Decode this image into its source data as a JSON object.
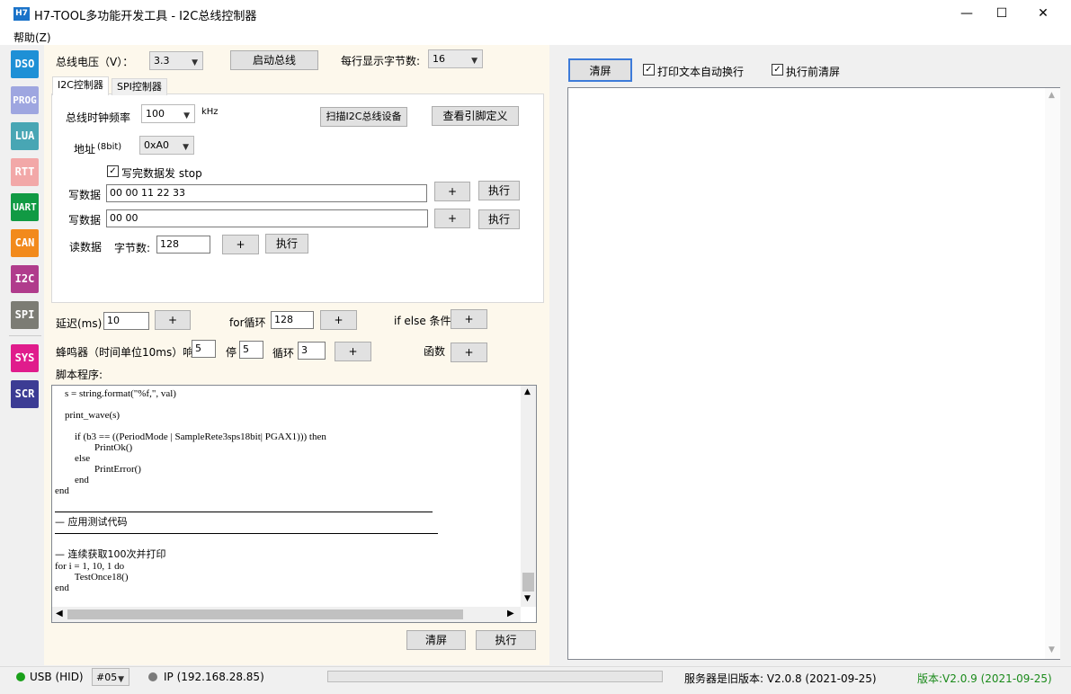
{
  "window": {
    "title": "H7-TOOL多功能开发工具 - I2C总线控制器",
    "icon_text": "H7",
    "minimize": "—",
    "maximize": "☐",
    "close": "✕"
  },
  "menu": {
    "help": "帮助(Z)"
  },
  "sidebar": [
    {
      "label": "DSO",
      "color": "#1e90d6"
    },
    {
      "label": "PROG",
      "color": "#9ea6e0"
    },
    {
      "label": "LUA",
      "color": "#48a6b4"
    },
    {
      "label": "RTT",
      "color": "#f2a8a8"
    },
    {
      "label": "UART",
      "color": "#119a44"
    },
    {
      "label": "CAN",
      "color": "#f28a1c"
    },
    {
      "label": "I2C",
      "color": "#b03c8c"
    },
    {
      "label": "SPI",
      "color": "#7c7c74"
    },
    {
      "label": "SYS",
      "color": "#e01c8c"
    },
    {
      "label": "SCR",
      "color": "#3c3c94"
    }
  ],
  "bus": {
    "voltage_label": "总线电压（V）：",
    "voltage_value": "3.3",
    "start_button": "启动总线",
    "bytes_per_line_label": "每行显示字节数:",
    "bytes_per_line_value": "16"
  },
  "tabs": [
    "I2C控制器",
    "SPI控制器"
  ],
  "i2c": {
    "clock_label": "总线时钟频率",
    "clock_value": "100",
    "clock_unit": "kHz",
    "scan_button": "扫描I2C总线设备",
    "pinout_button": "查看引脚定义",
    "addr_label": "地址",
    "addr_hint": "(8bit)",
    "addr_value": "0xA0",
    "stop_checkbox": "写完数据发 stop",
    "write_label": "写数据",
    "write1_value": "00 00 11 22 33",
    "write2_value": "00 00",
    "plus": "+",
    "exec": "执行",
    "read_label": "读数据",
    "read_bytes_label": "字节数:",
    "read_bytes_value": "128"
  },
  "script_tools": {
    "delay_label": "延迟(ms)",
    "delay_value": "10",
    "for_label": "for循环",
    "for_value": "128",
    "ifelse_label": "if else 条件",
    "beep_label": "蜂鸣器（时间单位10ms）响",
    "beep_on": "5",
    "stop_label": "停",
    "beep_off": "5",
    "loop_label": "循环",
    "loop_value": "3",
    "func_label": "函数",
    "script_label": "脚本程序:"
  },
  "script_lines": [
    "    s = string.format(\"%f,\", val)",
    "",
    "    print_wave(s)",
    "",
    "        if (b3 == ((PeriodMode | SampleRete3sps18bit| PGAX1))) then",
    "                PrintOk()",
    "        else",
    "                PrintError()",
    "        end",
    "end",
    "",
    "",
    "— 应用测试代码",
    "",
    "",
    "— 连续获取100次并打印",
    "for i = 1, 10, 1 do",
    "        TestOnce18()",
    "end"
  ],
  "script_buttons": {
    "clear": "清屏",
    "exec": "执行"
  },
  "right": {
    "clear_button": "清屏",
    "wrap_checkbox": "打印文本自动换行",
    "clear_before_checkbox": "执行前清屏"
  },
  "status": {
    "usb": "USB (HID)",
    "port": "#05",
    "ip": "IP (192.168.28.85)",
    "server": "服务器是旧版本: V2.0.8 (2021-09-25)",
    "version": "版本:V2.0.9 (2021-09-25)",
    "usb_color": "#1aa01a",
    "ip_color": "#7a7a7a",
    "version_color": "#1a8a1a"
  }
}
